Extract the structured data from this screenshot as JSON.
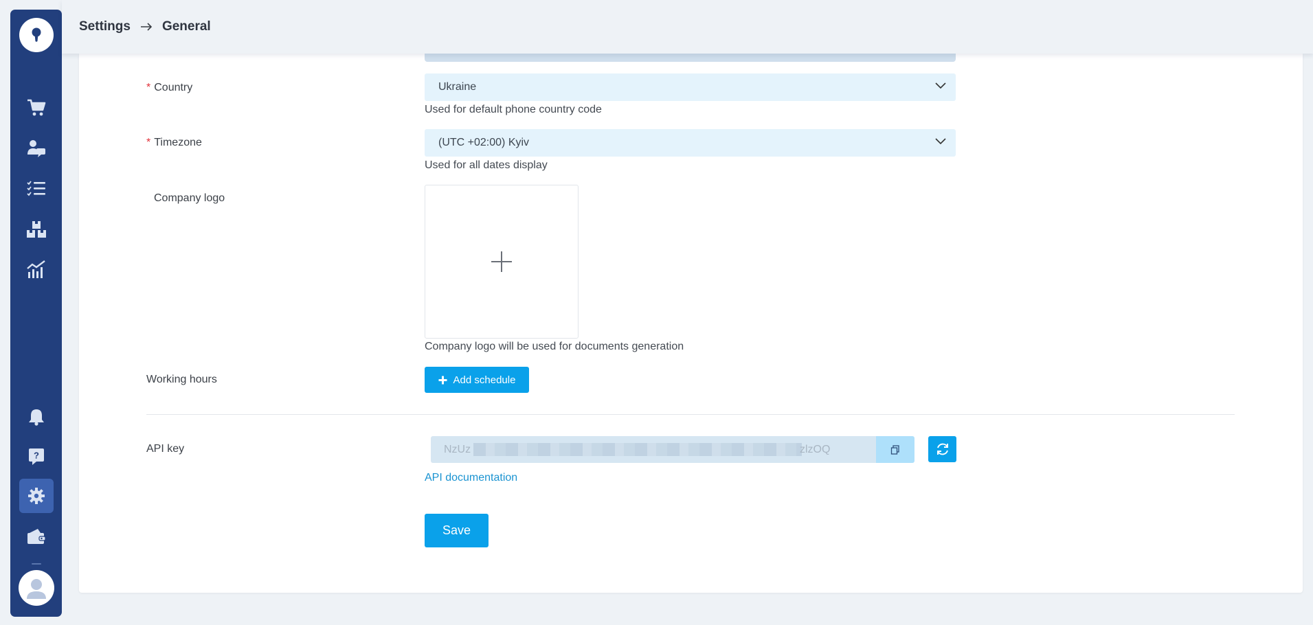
{
  "header": {
    "breadcrumb_parent": "Settings",
    "breadcrumb_current": "General"
  },
  "sidebar": {
    "items": [
      {
        "icon": "cart-icon"
      },
      {
        "icon": "customer-chat-icon"
      },
      {
        "icon": "task-list-icon"
      },
      {
        "icon": "warehouse-boxes-icon"
      },
      {
        "icon": "analytics-chart-icon"
      },
      {
        "icon": "bell-icon"
      },
      {
        "icon": "help-icon"
      },
      {
        "icon": "gear-icon",
        "active": true
      },
      {
        "icon": "wallet-icon"
      }
    ]
  },
  "form": {
    "country": {
      "label": "Country",
      "value": "Ukraine",
      "hint": "Used for default phone country code",
      "required": true
    },
    "timezone": {
      "label": "Timezone",
      "value": "(UTC +02:00) Kyiv",
      "hint": "Used for all dates display",
      "required": true
    },
    "company_logo": {
      "label": "Company logo",
      "hint": "Company logo will be used for documents generation"
    },
    "working_hours": {
      "label": "Working hours",
      "button": "Add schedule"
    },
    "api_key": {
      "label": "API key",
      "value_prefix": "NzUz",
      "value_suffix": "zlzOQ",
      "doc_link": "API documentation"
    },
    "save_label": "Save"
  },
  "colors": {
    "sidebar": "#223f7d",
    "sidebar_active": "#3d63b0",
    "primary": "#0aa1ea",
    "required": "#e2333b",
    "select_bg": "#e4f3fc"
  }
}
